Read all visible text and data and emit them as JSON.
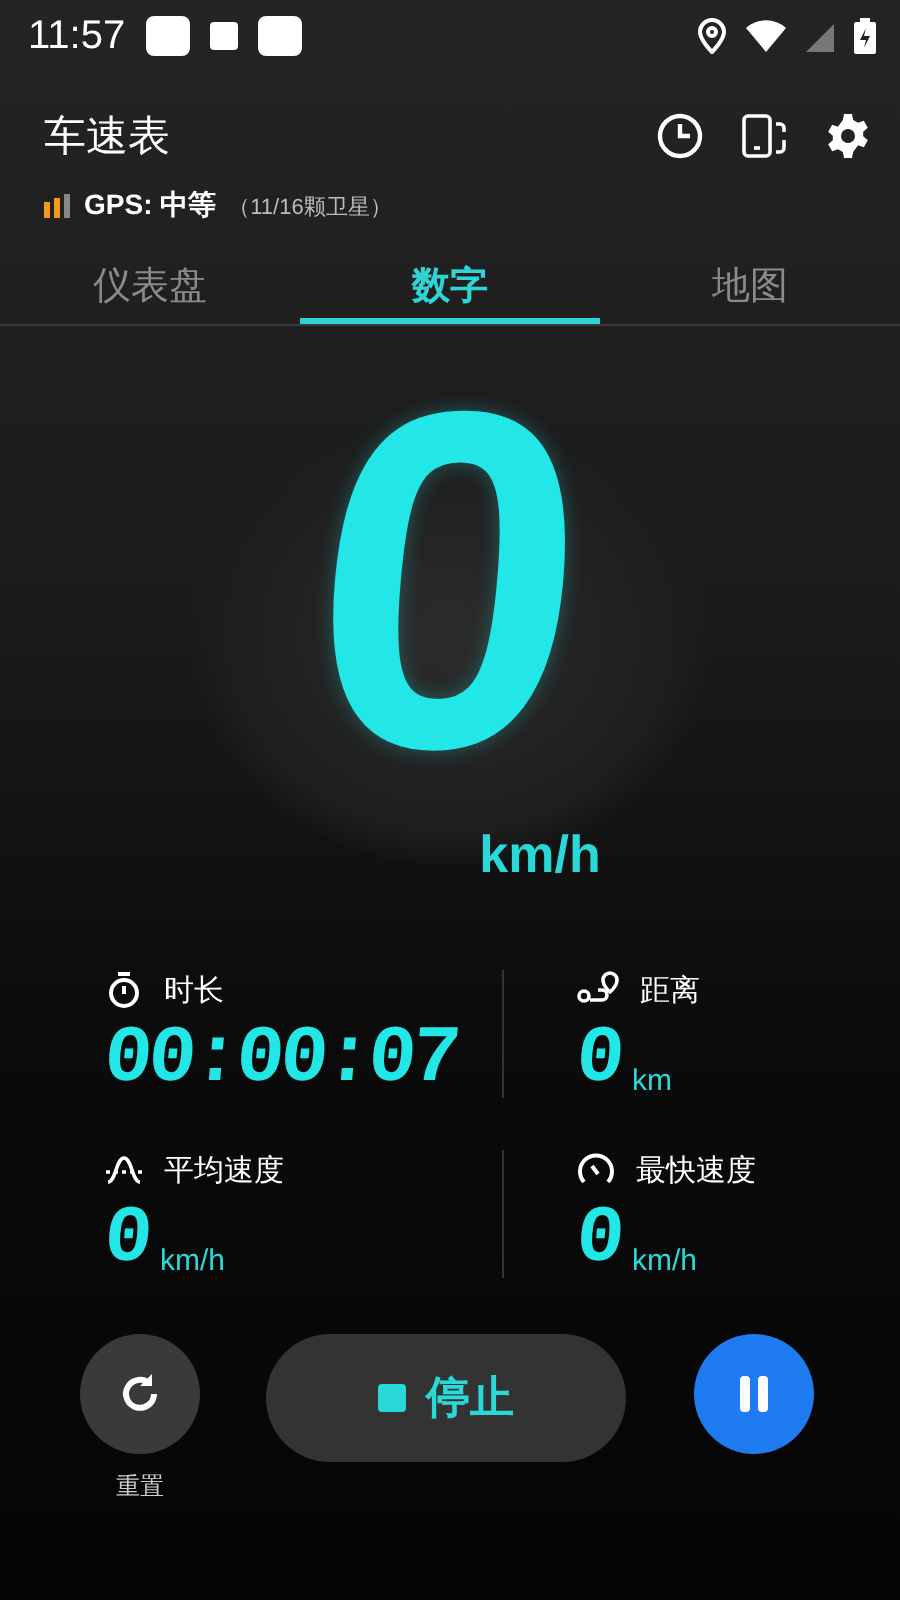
{
  "status_bar": {
    "time": "11:57"
  },
  "app_bar": {
    "title": "车速表",
    "gps_status": "GPS: 中等",
    "gps_detail": "（11/16颗卫星）"
  },
  "tabs": [
    {
      "label": "仪表盘",
      "selected": false
    },
    {
      "label": "数字",
      "selected": true
    },
    {
      "label": "地图",
      "selected": false
    }
  ],
  "speed": {
    "value": "0",
    "unit": "km/h"
  },
  "stats": [
    {
      "kind": "timer",
      "label": "时长",
      "value": "00:00:07"
    },
    {
      "kind": "distance",
      "label": "距离",
      "value": "0",
      "unit": "km"
    },
    {
      "kind": "average",
      "label": "平均速度",
      "value": "0",
      "unit": "km/h"
    },
    {
      "kind": "max",
      "label": "最快速度",
      "value": "0",
      "unit": "km/h"
    }
  ],
  "controls": {
    "reset_label": "重置",
    "stop_label": "停止"
  }
}
